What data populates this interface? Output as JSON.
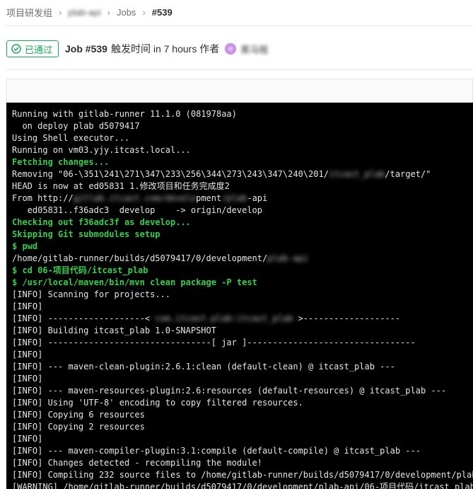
{
  "breadcrumb": {
    "group": "项目研发组",
    "project": "plab-api",
    "jobs": "Jobs",
    "current": "#539"
  },
  "job": {
    "status": "已通过",
    "title": "Job #539",
    "triggered_text": "触发时间 in 7 hours 作者",
    "author": "黑马程",
    "status_color": "#1aaa55"
  },
  "log": [
    {
      "parts": [
        {
          "t": "Running with gitlab-runner 11.1.0 (081978aa)"
        }
      ]
    },
    {
      "parts": [
        {
          "t": "  on deploy plab d5079417"
        }
      ]
    },
    {
      "parts": [
        {
          "t": "Using Shell executor..."
        }
      ]
    },
    {
      "parts": [
        {
          "t": "Running on vm03.yjy.itcast.local..."
        }
      ]
    },
    {
      "ok": true,
      "parts": [
        {
          "t": "Fetching changes..."
        }
      ]
    },
    {
      "parts": [
        {
          "t": "Removing \"06-\\351\\241\\271\\347\\233\\256\\344\\273\\243\\347\\240\\201/"
        },
        {
          "t": "itcast_plab",
          "b": true
        },
        {
          "t": "/target/\""
        }
      ]
    },
    {
      "parts": [
        {
          "t": "HEAD is now at ed05831 1.修改项目和任务完成度2"
        }
      ]
    },
    {
      "parts": [
        {
          "t": "From http://"
        },
        {
          "t": "gitlab.itcast.com/develo",
          "b": true
        },
        {
          "t": "pment"
        },
        {
          "t": "/plab",
          "b": true
        },
        {
          "t": "-api"
        }
      ]
    },
    {
      "parts": [
        {
          "t": "   ed05831..f36adc3  develop    -> origin/develop"
        }
      ]
    },
    {
      "ok": true,
      "parts": [
        {
          "t": "Checking out f36adc3f as develop..."
        }
      ]
    },
    {
      "ok": true,
      "parts": [
        {
          "t": "Skipping Git submodules setup"
        }
      ]
    },
    {
      "ok": true,
      "parts": [
        {
          "t": "$ pwd"
        }
      ]
    },
    {
      "parts": [
        {
          "t": "/home/gitlab-runner/builds/d5079417/0/development/"
        },
        {
          "t": "plab-api",
          "b": true
        }
      ]
    },
    {
      "ok": true,
      "parts": [
        {
          "t": "$ cd 06-项目代码/itcast_plab"
        }
      ]
    },
    {
      "ok": true,
      "parts": [
        {
          "t": "$ /usr/local/maven/bin/mvn clean package -P test"
        }
      ]
    },
    {
      "parts": [
        {
          "t": "[INFO] Scanning for projects..."
        }
      ]
    },
    {
      "parts": [
        {
          "t": "[INFO]"
        }
      ]
    },
    {
      "parts": [
        {
          "t": "[INFO] -------------------< "
        },
        {
          "t": "com.itcast.plab:itcast_plab",
          "b": true
        },
        {
          "t": " >-------------------"
        }
      ]
    },
    {
      "parts": [
        {
          "t": "[INFO] Building itcast_plab 1.0-SNAPSHOT"
        }
      ]
    },
    {
      "parts": [
        {
          "t": "[INFO] --------------------------------[ jar ]---------------------------------"
        }
      ]
    },
    {
      "parts": [
        {
          "t": "[INFO]"
        }
      ]
    },
    {
      "parts": [
        {
          "t": "[INFO] --- maven-clean-plugin:2.6.1:clean (default-clean) @ itcast_plab ---"
        }
      ]
    },
    {
      "parts": [
        {
          "t": "[INFO]"
        }
      ]
    },
    {
      "parts": [
        {
          "t": "[INFO] --- maven-resources-plugin:2.6:resources (default-resources) @ itcast_plab ---"
        }
      ]
    },
    {
      "parts": [
        {
          "t": "[INFO] Using 'UTF-8' encoding to copy filtered resources."
        }
      ]
    },
    {
      "parts": [
        {
          "t": "[INFO] Copying 6 resources"
        }
      ]
    },
    {
      "parts": [
        {
          "t": "[INFO] Copying 2 resources"
        }
      ]
    },
    {
      "parts": [
        {
          "t": "[INFO]"
        }
      ]
    },
    {
      "parts": [
        {
          "t": "[INFO] --- maven-compiler-plugin:3.1:compile (default-compile) @ itcast_plab ---"
        }
      ]
    },
    {
      "parts": [
        {
          "t": "[INFO] Changes detected - recompiling the module!"
        }
      ]
    },
    {
      "parts": [
        {
          "t": "[INFO] Compiling 232 source files to /home/gitlab-runner/builds/d5079417/0/development/plab"
        }
      ]
    },
    {
      "parts": [
        {
          "t": "[WARNING] /home/gitlab-runner/builds/d5079417/0/development/plab-api/06-项目代码/itcast_plab"
        }
      ]
    }
  ]
}
